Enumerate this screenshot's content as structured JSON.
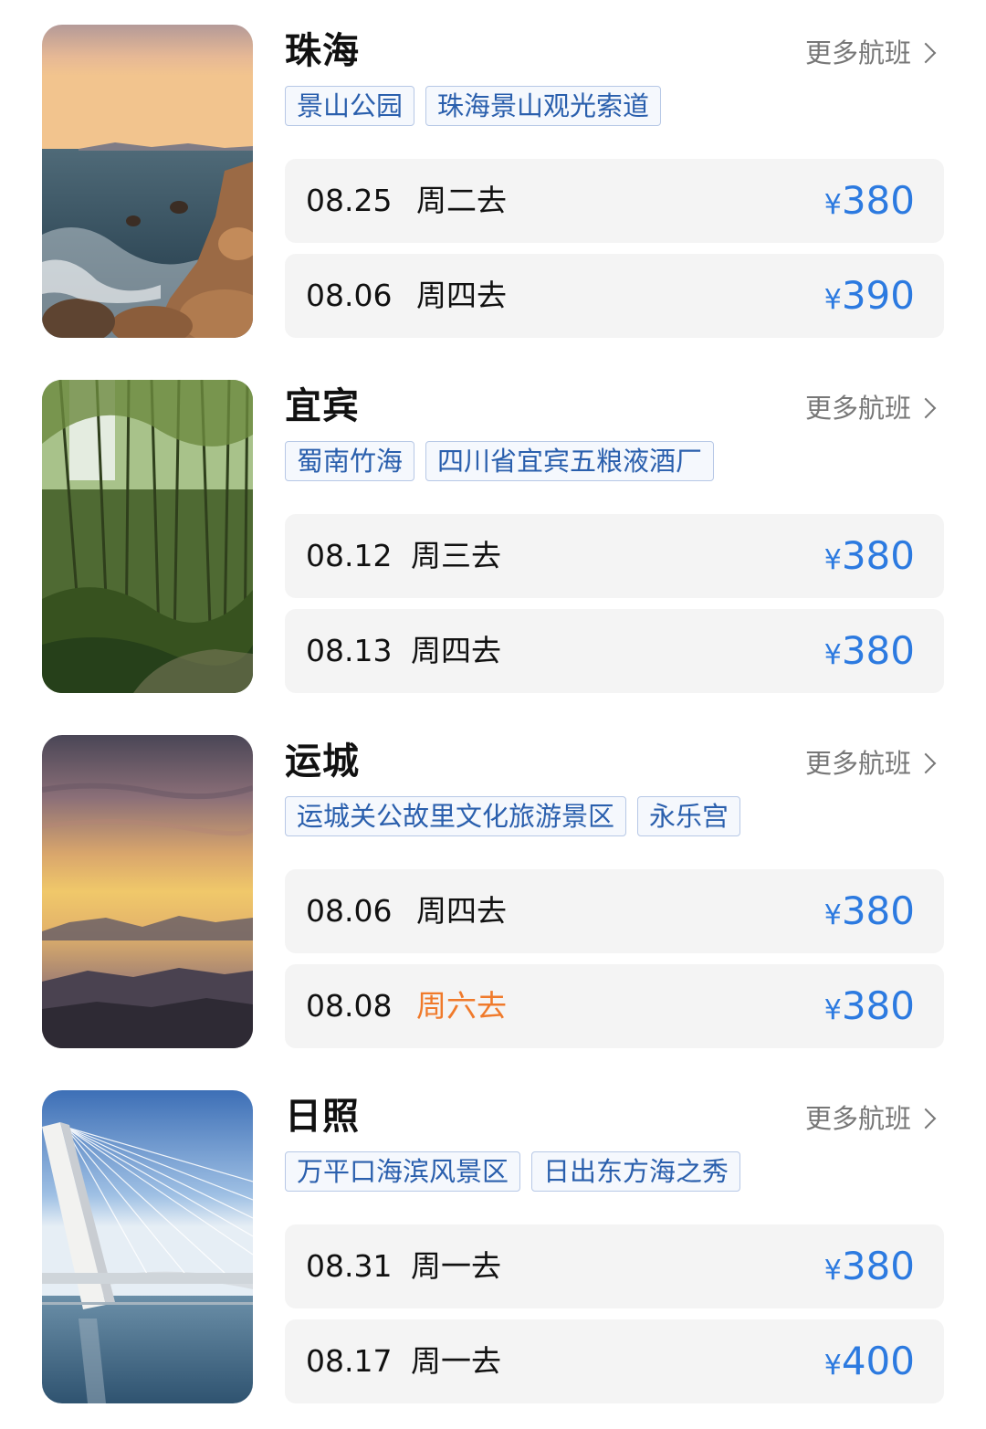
{
  "more_label": "更多航班",
  "colors": {
    "accent_blue": "#2c7ae0",
    "weekend_orange": "#f07a2b",
    "tag_border": "#b7c8e6",
    "tag_text": "#2a5fad",
    "row_bg": "#f4f4f4"
  },
  "destinations": [
    {
      "city": "珠海",
      "image": "sea-rocks-sunset",
      "tags": [
        "景山公园",
        "珠海景山观光索道"
      ],
      "flights": [
        {
          "date": "08.25",
          "day": "周二去",
          "currency": "¥",
          "price": "380"
        },
        {
          "date": "08.06",
          "day": "周四去",
          "currency": "¥",
          "price": "390"
        }
      ]
    },
    {
      "city": "宜宾",
      "image": "bamboo-forest",
      "tags": [
        "蜀南竹海",
        "四川省宜宾五粮液酒厂"
      ],
      "flights": [
        {
          "date": "08.12",
          "day": "周三去",
          "currency": "¥",
          "price": "380"
        },
        {
          "date": "08.13",
          "day": "周四去",
          "currency": "¥",
          "price": "380"
        }
      ]
    },
    {
      "city": "运城",
      "image": "mountain-sunset",
      "tags": [
        "运城关公故里文化旅游景区",
        "永乐宫"
      ],
      "flights": [
        {
          "date": "08.06",
          "day": "周四去",
          "currency": "¥",
          "price": "380"
        },
        {
          "date": "08.08",
          "day": "周六去",
          "currency": "¥",
          "price": "380",
          "weekend": true
        }
      ]
    },
    {
      "city": "日照",
      "image": "cable-bridge",
      "tags": [
        "万平口海滨风景区",
        "日出东方海之秀"
      ],
      "flights": [
        {
          "date": "08.31",
          "day": "周一去",
          "currency": "¥",
          "price": "380"
        },
        {
          "date": "08.17",
          "day": "周一去",
          "currency": "¥",
          "price": "400"
        }
      ]
    }
  ]
}
